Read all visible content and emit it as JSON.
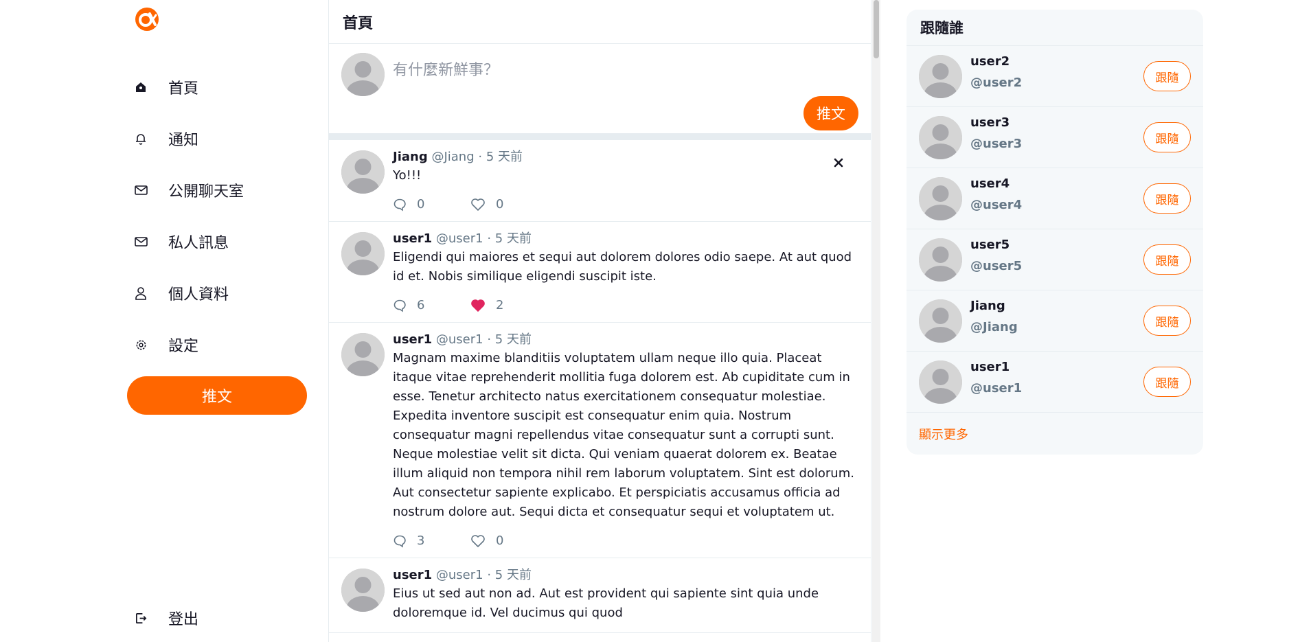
{
  "colors": {
    "brand": "#ff6600",
    "text": "#171725",
    "muted": "#657786",
    "heart": "#e0245e",
    "border": "#e6ecf0"
  },
  "sidebar": {
    "logo_icon": "alphacamp-logo-icon",
    "items": [
      {
        "label": "首頁",
        "icon": "home-icon"
      },
      {
        "label": "通知",
        "icon": "bell-icon"
      },
      {
        "label": "公開聊天室",
        "icon": "mail-icon"
      },
      {
        "label": "私人訊息",
        "icon": "mail-icon"
      },
      {
        "label": "個人資料",
        "icon": "user-icon"
      },
      {
        "label": "設定",
        "icon": "gear-icon"
      }
    ],
    "tweet_button": "推文",
    "logout": {
      "label": "登出",
      "icon": "logout-icon"
    }
  },
  "main": {
    "title": "首頁",
    "composer": {
      "placeholder": "有什麼新鮮事？",
      "button": "推文"
    },
    "tweets": [
      {
        "name": "Jiang",
        "handle": "@Jiang",
        "sep": "·",
        "time": "5 天前",
        "text": "Yo!!!",
        "replies": "0",
        "likes": "0",
        "liked": false,
        "deletable": true
      },
      {
        "name": "user1",
        "handle": "@user1",
        "sep": "·",
        "time": "5 天前",
        "text": "Eligendi qui maiores et sequi aut dolorem dolores odio saepe. At aut quod id et. Nobis similique eligendi suscipit iste.",
        "replies": "6",
        "likes": "2",
        "liked": true,
        "deletable": false
      },
      {
        "name": "user1",
        "handle": "@user1",
        "sep": "·",
        "time": "5 天前",
        "text": "Magnam maxime blanditiis voluptatem ullam neque illo quia. Placeat itaque vitae reprehenderit mollitia fuga dolorem est. Ab cupiditate cum in esse. Tenetur architecto natus exercitationem consequatur molestiae. Expedita inventore suscipit est consequatur enim quia. Nostrum consequatur magni repellendus vitae consequatur sunt a corrupti sunt. Neque molestiae velit sit dicta. Qui veniam quaerat dolorem ex. Beatae illum aliquid non tempora nihil rem laborum voluptatem. Sint est dolorum. Aut consectetur sapiente explicabo. Et perspiciatis accusamus officia ad nostrum dolore aut. Sequi dicta et consequatur sequi et voluptatem ut.",
        "replies": "3",
        "likes": "0",
        "liked": false,
        "deletable": false
      },
      {
        "name": "user1",
        "handle": "@user1",
        "sep": "·",
        "time": "5 天前",
        "text": "Eius ut sed aut non ad. Aut est provident qui sapiente sint quia unde doloremque id. Vel ducimus qui quod",
        "replies": "",
        "likes": "",
        "liked": false,
        "deletable": false
      }
    ]
  },
  "follow": {
    "title": "跟隨誰",
    "button_label": "跟隨",
    "users": [
      {
        "name": "user2",
        "handle": "@user2"
      },
      {
        "name": "user3",
        "handle": "@user3"
      },
      {
        "name": "user4",
        "handle": "@user4"
      },
      {
        "name": "user5",
        "handle": "@user5"
      },
      {
        "name": "Jiang",
        "handle": "@Jiang"
      },
      {
        "name": "user1",
        "handle": "@user1"
      }
    ],
    "show_more": "顯示更多"
  }
}
